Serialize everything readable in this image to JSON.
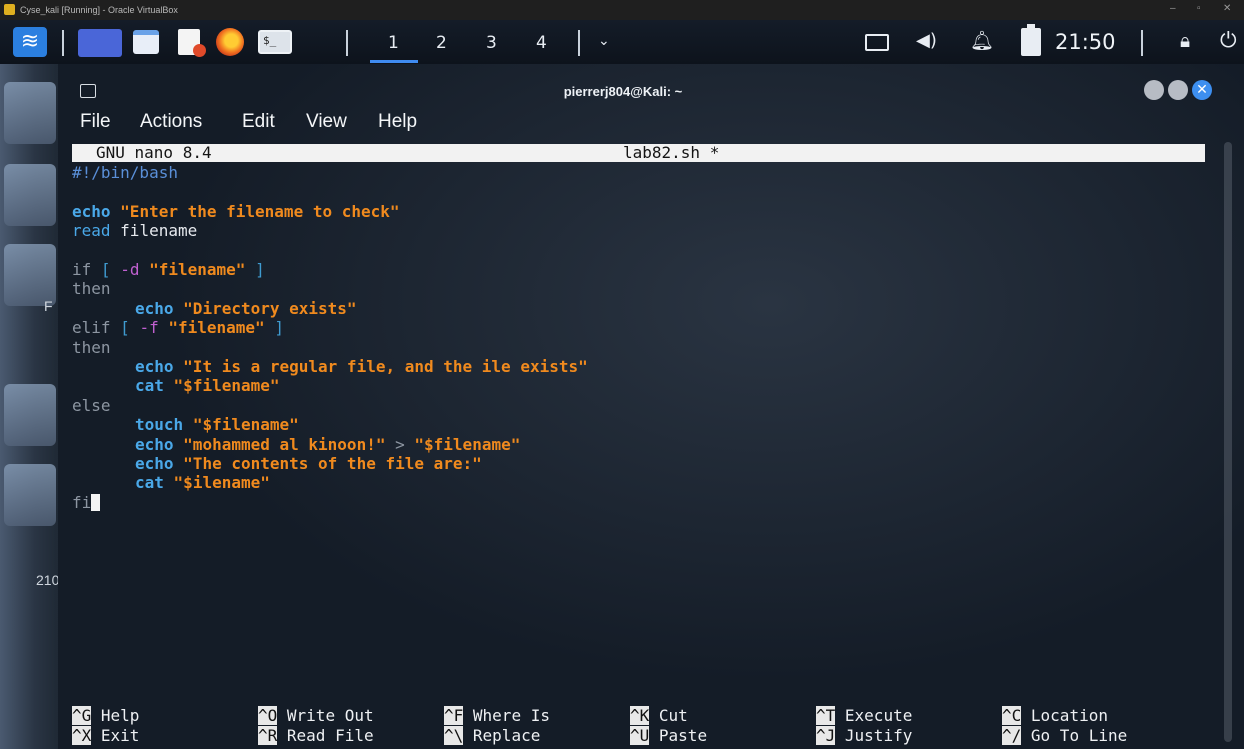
{
  "vbox": {
    "title": "Cyse_kali [Running] - Oracle VirtualBox",
    "minimize": "–",
    "restore": "▫",
    "close": "✕"
  },
  "panel": {
    "terminal_icon_text": "$_",
    "workspaces": [
      "1",
      "2",
      "3",
      "4"
    ],
    "clock": "21:50",
    "icons": [
      "kali-logo-icon",
      "app-launcher-icon",
      "file-manager-icon",
      "text-editor-icon",
      "firefox-icon",
      "terminal-icon",
      "display-icon",
      "volume-icon",
      "bell-icon",
      "battery-icon",
      "lock-icon",
      "logout-icon"
    ]
  },
  "desktop": {
    "label_1": "F",
    "label_2": "210"
  },
  "terminal": {
    "title": "pierrerj804@Kali: ~",
    "menu": {
      "file": "File",
      "actions": "Actions",
      "edit": "Edit",
      "view": "View",
      "help": "Help"
    }
  },
  "nano": {
    "version": "GNU nano 8.4",
    "filename": "lab82.sh *",
    "code": {
      "l1": "#!/bin/bash",
      "l3_kw": "echo",
      "l3_str": "\"Enter the filename to check\"",
      "l4_kw": "read",
      "l4_txt": "filename",
      "l6_if": "if",
      "l6_open": "[",
      "l6_opt": "-d",
      "l6_str": "\"filename\"",
      "l6_close": "]",
      "l7": "then",
      "l8_kw": "echo",
      "l8_str": "\"Directory exists\"",
      "l9_elif": "elif",
      "l9_open": "[",
      "l9_opt": "-f",
      "l9_str": "\"filename\"",
      "l9_close": "]",
      "l10": "then",
      "l11_kw": "echo",
      "l11_str": "\"It is a regular file, and the ile exists\"",
      "l12_kw": "cat",
      "l12_str": "\"$filename\"",
      "l13": "else",
      "l14_kw": "touch",
      "l14_str": "\"$filename\"",
      "l15_kw": "echo",
      "l15_str": "\"mohammed al kinoon!\"",
      "l15_op": ">",
      "l15_str2": "\"$filename\"",
      "l16_kw": "echo",
      "l16_str": "\"The contents of the file are:\"",
      "l17_kw": "cat",
      "l17_str": "\"$ilename\"",
      "l18": "fi"
    },
    "shortcuts": {
      "help_key": "^G",
      "help": "Help",
      "write_key": "^O",
      "write": "Write Out",
      "where_key": "^F",
      "where": "Where Is",
      "cut_key": "^K",
      "cut": "Cut",
      "execute_key": "^T",
      "execute": "Execute",
      "location_key": "^C",
      "location": "Location",
      "exit_key": "^X",
      "exit": "Exit",
      "read_key": "^R",
      "read": "Read File",
      "replace_key": "^\\",
      "replace": "Replace",
      "paste_key": "^U",
      "paste": "Paste",
      "justify_key": "^J",
      "justify": "Justify",
      "goto_key": "^/",
      "goto": "Go To Line"
    }
  }
}
